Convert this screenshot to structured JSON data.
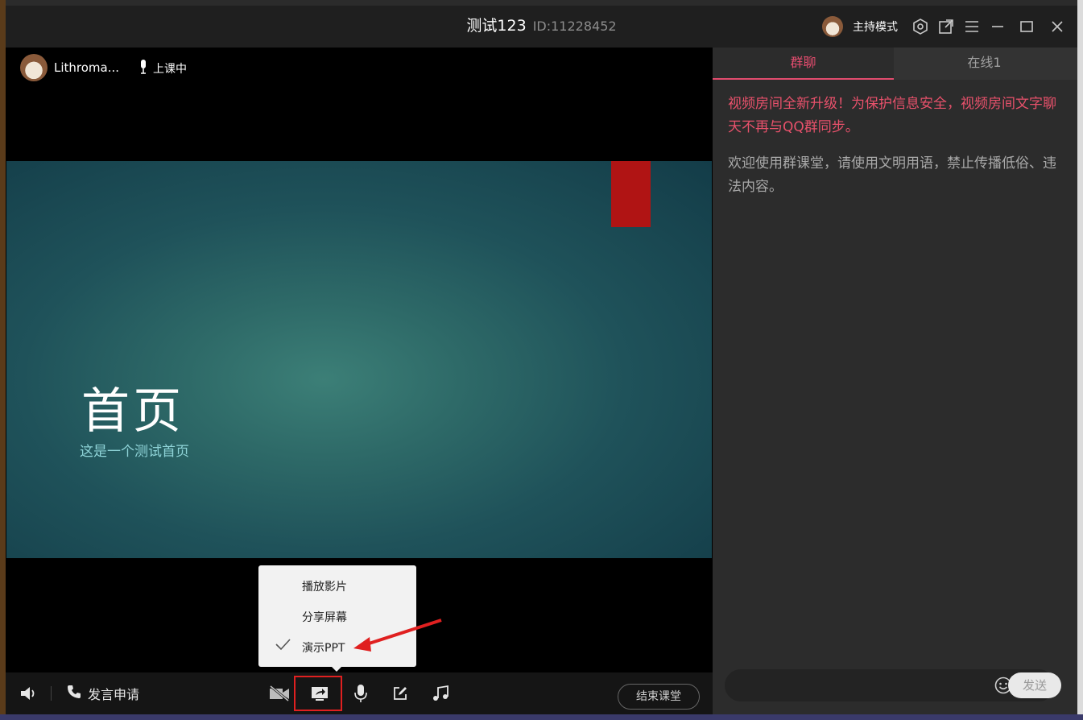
{
  "window": {
    "title": "测试123",
    "room_id": "ID:11228452",
    "mode_label": "主持模式"
  },
  "presenter": {
    "name": "Lithroma...",
    "status": "上课中"
  },
  "slide": {
    "title": "首页",
    "subtitle": "这是一个测试首页"
  },
  "share_menu": {
    "items": [
      {
        "label": "播放影片",
        "checked": false
      },
      {
        "label": "分享屏幕",
        "checked": false
      },
      {
        "label": "演示PPT",
        "checked": true
      }
    ]
  },
  "controls": {
    "speak_request": "发言申请",
    "end_class": "结束课堂"
  },
  "chat": {
    "tabs": [
      "群聊",
      "在线1"
    ],
    "notice": "视频房间全新升级！为保护信息安全，视频房间文字聊天不再与QQ群同步。",
    "welcome": "欢迎使用群课堂，请使用文明用语，禁止传播低俗、违法内容。",
    "send_label": "发送"
  },
  "colors": {
    "accent": "#e24c6e",
    "highlight": "#e02020"
  }
}
